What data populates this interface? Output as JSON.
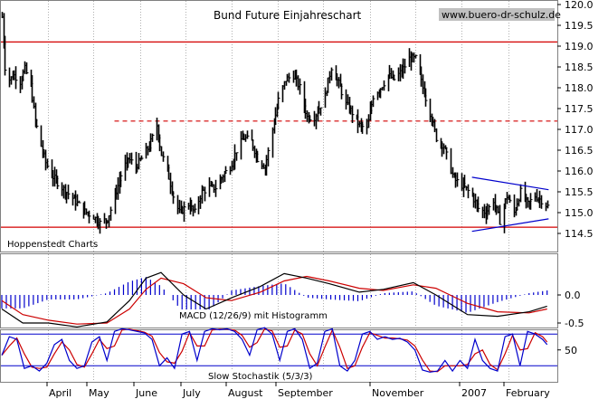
{
  "chart_data": [
    {
      "type": "candlestick",
      "title": "Bund Future Einjahreschart",
      "source": "www.buero-dr-schulz.de",
      "watermark": "Hoppenstedt Charts",
      "y_ticks": [
        "114.5",
        "115.0",
        "115.5",
        "116.0",
        "116.5",
        "117.0",
        "117.5",
        "118.0",
        "118.5",
        "119.0",
        "119.5",
        "120.0"
      ],
      "ylim": [
        114.5,
        120.0
      ],
      "x_ticks": [
        "April",
        "May",
        "June",
        "July",
        "August",
        "September",
        "November",
        "2007",
        "February"
      ],
      "guide_lines": [
        {
          "name": "resistance",
          "style": "solid",
          "color": "#d40000",
          "y": 119.1
        },
        {
          "name": "mid-line",
          "style": "dashed",
          "color": "#d40000",
          "y": 117.2
        },
        {
          "name": "support",
          "style": "solid",
          "color": "#d40000",
          "y": 114.65
        }
      ],
      "triangle": {
        "color": "#0000cc",
        "upper": [
          {
            "x": "2007-01-08",
            "y": 115.85
          },
          {
            "x": "2007-02-28",
            "y": 115.55
          }
        ],
        "lower": [
          {
            "x": "2007-01-08",
            "y": 114.55
          },
          {
            "x": "2007-02-28",
            "y": 114.85
          }
        ]
      },
      "close_series": [
        {
          "x": "2006-03-01",
          "y": 119.7
        },
        {
          "x": "2006-03-03",
          "y": 118.5
        },
        {
          "x": "2006-03-06",
          "y": 118.2
        },
        {
          "x": "2006-03-09",
          "y": 118.3
        },
        {
          "x": "2006-03-13",
          "y": 118.15
        },
        {
          "x": "2006-03-16",
          "y": 118.45
        },
        {
          "x": "2006-03-20",
          "y": 118.05
        },
        {
          "x": "2006-03-23",
          "y": 117.2
        },
        {
          "x": "2006-03-27",
          "y": 116.6
        },
        {
          "x": "2006-03-30",
          "y": 116.2
        },
        {
          "x": "2006-04-03",
          "y": 115.9
        },
        {
          "x": "2006-04-10",
          "y": 115.6
        },
        {
          "x": "2006-04-17",
          "y": 115.35
        },
        {
          "x": "2006-04-24",
          "y": 115.05
        },
        {
          "x": "2006-05-01",
          "y": 114.9
        },
        {
          "x": "2006-05-05",
          "y": 114.75
        },
        {
          "x": "2006-05-10",
          "y": 114.85
        },
        {
          "x": "2006-05-15",
          "y": 115.4
        },
        {
          "x": "2006-05-19",
          "y": 115.9
        },
        {
          "x": "2006-05-24",
          "y": 116.3
        },
        {
          "x": "2006-05-29",
          "y": 116.1
        },
        {
          "x": "2006-06-02",
          "y": 116.3
        },
        {
          "x": "2006-06-07",
          "y": 116.6
        },
        {
          "x": "2006-06-12",
          "y": 117.1
        },
        {
          "x": "2006-06-15",
          "y": 116.4
        },
        {
          "x": "2006-06-19",
          "y": 116.0
        },
        {
          "x": "2006-06-23",
          "y": 115.4
        },
        {
          "x": "2006-06-27",
          "y": 115.0
        },
        {
          "x": "2006-07-03",
          "y": 115.2
        },
        {
          "x": "2006-07-07",
          "y": 115.0
        },
        {
          "x": "2006-07-12",
          "y": 115.5
        },
        {
          "x": "2006-07-17",
          "y": 115.6
        },
        {
          "x": "2006-07-21",
          "y": 115.6
        },
        {
          "x": "2006-07-26",
          "y": 115.9
        },
        {
          "x": "2006-07-31",
          "y": 116.1
        },
        {
          "x": "2006-08-04",
          "y": 116.5
        },
        {
          "x": "2006-08-09",
          "y": 116.8
        },
        {
          "x": "2006-08-14",
          "y": 116.7
        },
        {
          "x": "2006-08-18",
          "y": 116.3
        },
        {
          "x": "2006-08-23",
          "y": 116.1
        },
        {
          "x": "2006-08-28",
          "y": 117.0
        },
        {
          "x": "2006-09-01",
          "y": 117.7
        },
        {
          "x": "2006-09-06",
          "y": 118.2
        },
        {
          "x": "2006-09-11",
          "y": 118.3
        },
        {
          "x": "2006-09-15",
          "y": 118.0
        },
        {
          "x": "2006-09-20",
          "y": 117.3
        },
        {
          "x": "2006-09-25",
          "y": 117.3
        },
        {
          "x": "2006-10-02",
          "y": 117.8
        },
        {
          "x": "2006-10-06",
          "y": 118.5
        },
        {
          "x": "2006-10-11",
          "y": 118.1
        },
        {
          "x": "2006-10-16",
          "y": 117.6
        },
        {
          "x": "2006-10-20",
          "y": 117.4
        },
        {
          "x": "2006-10-25",
          "y": 117.1
        },
        {
          "x": "2006-10-30",
          "y": 117.0
        },
        {
          "x": "2006-11-03",
          "y": 117.8
        },
        {
          "x": "2006-11-08",
          "y": 118.0
        },
        {
          "x": "2006-11-13",
          "y": 118.3
        },
        {
          "x": "2006-11-17",
          "y": 118.2
        },
        {
          "x": "2006-11-22",
          "y": 118.4
        },
        {
          "x": "2006-11-27",
          "y": 118.7
        },
        {
          "x": "2006-12-01",
          "y": 118.7
        },
        {
          "x": "2006-12-06",
          "y": 118.0
        },
        {
          "x": "2006-12-11",
          "y": 117.4
        },
        {
          "x": "2006-12-15",
          "y": 116.8
        },
        {
          "x": "2006-12-20",
          "y": 116.6
        },
        {
          "x": "2006-12-27",
          "y": 115.8
        },
        {
          "x": "2007-01-03",
          "y": 115.6
        },
        {
          "x": "2007-01-08",
          "y": 115.4
        },
        {
          "x": "2007-01-12",
          "y": 115.1
        },
        {
          "x": "2007-01-17",
          "y": 115.0
        },
        {
          "x": "2007-01-22",
          "y": 115.3
        },
        {
          "x": "2007-01-26",
          "y": 114.8
        },
        {
          "x": "2007-01-31",
          "y": 115.4
        },
        {
          "x": "2007-02-05",
          "y": 115.0
        },
        {
          "x": "2007-02-09",
          "y": 115.5
        },
        {
          "x": "2007-02-14",
          "y": 115.2
        },
        {
          "x": "2007-02-19",
          "y": 115.4
        },
        {
          "x": "2007-02-23",
          "y": 115.3
        },
        {
          "x": "2007-02-27",
          "y": 115.15
        }
      ]
    },
    {
      "type": "line+histogram",
      "label": "MACD (12/26/9) mit Histogramm",
      "y_ticks": [
        "0.0",
        "-0.5"
      ],
      "series": [
        {
          "name": "MACD",
          "color": "#000000"
        },
        {
          "name": "Signal",
          "color": "#cc0000"
        },
        {
          "name": "Histogramm",
          "color": "#0000cc"
        }
      ],
      "macd": [
        {
          "x": "2006-03-01",
          "y": -0.25
        },
        {
          "x": "2006-03-15",
          "y": -0.5
        },
        {
          "x": "2006-04-01",
          "y": -0.5
        },
        {
          "x": "2006-04-20",
          "y": -0.57
        },
        {
          "x": "2006-05-10",
          "y": -0.48
        },
        {
          "x": "2006-05-25",
          "y": -0.1
        },
        {
          "x": "2006-06-05",
          "y": 0.3
        },
        {
          "x": "2006-06-15",
          "y": 0.4
        },
        {
          "x": "2006-06-30",
          "y": 0.0
        },
        {
          "x": "2006-07-15",
          "y": -0.25
        },
        {
          "x": "2006-08-01",
          "y": -0.05
        },
        {
          "x": "2006-08-20",
          "y": 0.15
        },
        {
          "x": "2006-09-05",
          "y": 0.38
        },
        {
          "x": "2006-09-20",
          "y": 0.3
        },
        {
          "x": "2006-10-05",
          "y": 0.2
        },
        {
          "x": "2006-10-25",
          "y": 0.05
        },
        {
          "x": "2006-11-10",
          "y": 0.1
        },
        {
          "x": "2006-11-30",
          "y": 0.22
        },
        {
          "x": "2006-12-15",
          "y": 0.0
        },
        {
          "x": "2007-01-05",
          "y": -0.35
        },
        {
          "x": "2007-01-25",
          "y": -0.38
        },
        {
          "x": "2007-02-15",
          "y": -0.3
        },
        {
          "x": "2007-02-27",
          "y": -0.2
        }
      ],
      "signal": [
        {
          "x": "2006-03-01",
          "y": -0.1
        },
        {
          "x": "2006-03-15",
          "y": -0.35
        },
        {
          "x": "2006-04-01",
          "y": -0.45
        },
        {
          "x": "2006-04-20",
          "y": -0.52
        },
        {
          "x": "2006-05-10",
          "y": -0.5
        },
        {
          "x": "2006-05-25",
          "y": -0.25
        },
        {
          "x": "2006-06-05",
          "y": 0.1
        },
        {
          "x": "2006-06-15",
          "y": 0.3
        },
        {
          "x": "2006-06-30",
          "y": 0.2
        },
        {
          "x": "2006-07-15",
          "y": -0.05
        },
        {
          "x": "2006-08-01",
          "y": -0.1
        },
        {
          "x": "2006-08-20",
          "y": 0.05
        },
        {
          "x": "2006-09-05",
          "y": 0.25
        },
        {
          "x": "2006-09-20",
          "y": 0.33
        },
        {
          "x": "2006-10-05",
          "y": 0.25
        },
        {
          "x": "2006-10-25",
          "y": 0.12
        },
        {
          "x": "2006-11-10",
          "y": 0.08
        },
        {
          "x": "2006-11-30",
          "y": 0.18
        },
        {
          "x": "2006-12-15",
          "y": 0.12
        },
        {
          "x": "2007-01-05",
          "y": -0.15
        },
        {
          "x": "2007-01-25",
          "y": -0.3
        },
        {
          "x": "2007-02-15",
          "y": -0.32
        },
        {
          "x": "2007-02-27",
          "y": -0.25
        }
      ]
    },
    {
      "type": "line",
      "label": "Slow Stochastik (5/3/3)",
      "y_ticks": [
        "50"
      ],
      "levels": [
        80,
        20
      ],
      "series": [
        {
          "name": "%K",
          "color": "#0000cc"
        },
        {
          "name": "%D",
          "color": "#cc0000"
        }
      ],
      "k": [
        {
          "x": "2006-03-01",
          "y": 40
        },
        {
          "x": "2006-03-06",
          "y": 75
        },
        {
          "x": "2006-03-11",
          "y": 70
        },
        {
          "x": "2006-03-16",
          "y": 15
        },
        {
          "x": "2006-03-21",
          "y": 20
        },
        {
          "x": "2006-03-26",
          "y": 10
        },
        {
          "x": "2006-03-31",
          "y": 25
        },
        {
          "x": "2006-04-05",
          "y": 60
        },
        {
          "x": "2006-04-10",
          "y": 70
        },
        {
          "x": "2006-04-15",
          "y": 30
        },
        {
          "x": "2006-04-20",
          "y": 15
        },
        {
          "x": "2006-04-25",
          "y": 20
        },
        {
          "x": "2006-04-30",
          "y": 65
        },
        {
          "x": "2006-05-05",
          "y": 75
        },
        {
          "x": "2006-05-10",
          "y": 30
        },
        {
          "x": "2006-05-15",
          "y": 85
        },
        {
          "x": "2006-05-20",
          "y": 90
        },
        {
          "x": "2006-05-25",
          "y": 88
        },
        {
          "x": "2006-05-30",
          "y": 85
        },
        {
          "x": "2006-06-04",
          "y": 82
        },
        {
          "x": "2006-06-09",
          "y": 70
        },
        {
          "x": "2006-06-14",
          "y": 20
        },
        {
          "x": "2006-06-19",
          "y": 35
        },
        {
          "x": "2006-06-24",
          "y": 15
        },
        {
          "x": "2006-06-29",
          "y": 80
        },
        {
          "x": "2006-07-04",
          "y": 85
        },
        {
          "x": "2006-07-09",
          "y": 30
        },
        {
          "x": "2006-07-14",
          "y": 85
        },
        {
          "x": "2006-07-19",
          "y": 90
        },
        {
          "x": "2006-07-24",
          "y": 88
        },
        {
          "x": "2006-07-29",
          "y": 90
        },
        {
          "x": "2006-08-03",
          "y": 85
        },
        {
          "x": "2006-08-08",
          "y": 70
        },
        {
          "x": "2006-08-13",
          "y": 40
        },
        {
          "x": "2006-08-18",
          "y": 88
        },
        {
          "x": "2006-08-23",
          "y": 92
        },
        {
          "x": "2006-08-28",
          "y": 80
        },
        {
          "x": "2006-09-02",
          "y": 30
        },
        {
          "x": "2006-09-07",
          "y": 85
        },
        {
          "x": "2006-09-12",
          "y": 90
        },
        {
          "x": "2006-09-17",
          "y": 70
        },
        {
          "x": "2006-09-22",
          "y": 15
        },
        {
          "x": "2006-09-27",
          "y": 25
        },
        {
          "x": "2006-10-02",
          "y": 85
        },
        {
          "x": "2006-10-07",
          "y": 90
        },
        {
          "x": "2006-10-12",
          "y": 20
        },
        {
          "x": "2006-10-17",
          "y": 10
        },
        {
          "x": "2006-10-22",
          "y": 30
        },
        {
          "x": "2006-10-27",
          "y": 80
        },
        {
          "x": "2006-11-01",
          "y": 85
        },
        {
          "x": "2006-11-06",
          "y": 70
        },
        {
          "x": "2006-11-11",
          "y": 75
        },
        {
          "x": "2006-11-16",
          "y": 70
        },
        {
          "x": "2006-11-21",
          "y": 72
        },
        {
          "x": "2006-11-26",
          "y": 65
        },
        {
          "x": "2006-12-01",
          "y": 50
        },
        {
          "x": "2006-12-06",
          "y": 12
        },
        {
          "x": "2006-12-11",
          "y": 8
        },
        {
          "x": "2006-12-16",
          "y": 10
        },
        {
          "x": "2006-12-21",
          "y": 30
        },
        {
          "x": "2006-12-26",
          "y": 10
        },
        {
          "x": "2006-12-31",
          "y": 30
        },
        {
          "x": "2007-01-05",
          "y": 15
        },
        {
          "x": "2007-01-10",
          "y": 70
        },
        {
          "x": "2007-01-15",
          "y": 30
        },
        {
          "x": "2007-01-20",
          "y": 15
        },
        {
          "x": "2007-01-25",
          "y": 10
        },
        {
          "x": "2007-01-30",
          "y": 75
        },
        {
          "x": "2007-02-04",
          "y": 80
        },
        {
          "x": "2007-02-09",
          "y": 20
        },
        {
          "x": "2007-02-14",
          "y": 85
        },
        {
          "x": "2007-02-19",
          "y": 80
        },
        {
          "x": "2007-02-24",
          "y": 70
        },
        {
          "x": "2007-02-27",
          "y": 60
        }
      ]
    }
  ]
}
